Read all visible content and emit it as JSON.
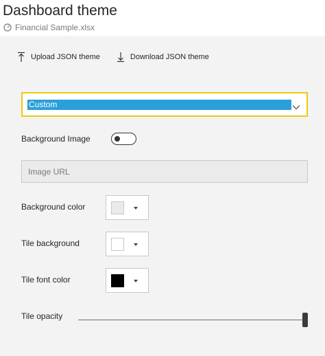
{
  "header": {
    "title": "Dashboard theme",
    "subtitle": "Financial Sample.xlsx"
  },
  "actions": {
    "upload_label": "Upload JSON theme",
    "download_label": "Download JSON theme"
  },
  "theme_select": {
    "value": "Custom"
  },
  "background_image": {
    "label": "Background Image",
    "toggle_on": false,
    "url_placeholder": "Image URL"
  },
  "background_color": {
    "label": "Background color",
    "swatch": "#eaeaea"
  },
  "tile_background": {
    "label": "Tile background",
    "swatch": "#ffffff"
  },
  "tile_font_color": {
    "label": "Tile font color",
    "swatch": "#000000"
  },
  "tile_opacity": {
    "label": "Tile opacity",
    "value_fraction": 1.0
  },
  "colors": {
    "accent_border": "#f2c811",
    "selection": "#2b9fd9",
    "panel_bg": "#f3f3f3"
  }
}
